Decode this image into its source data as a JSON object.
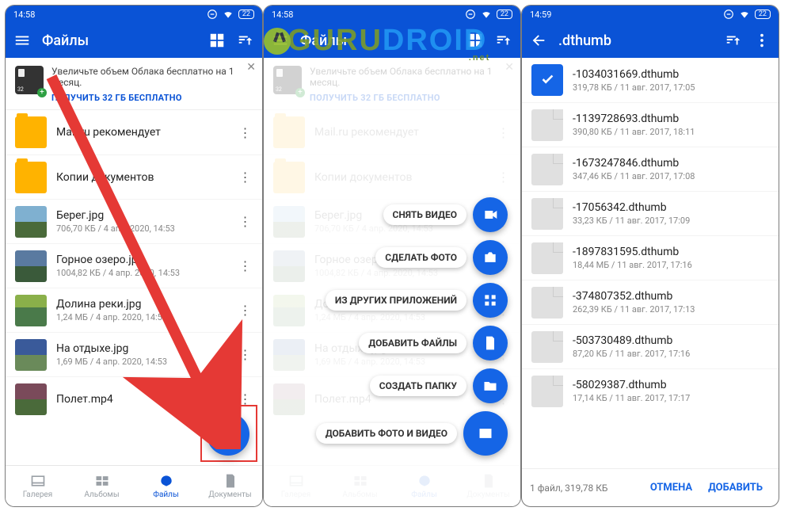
{
  "watermark": {
    "text1": "GURU",
    "text2": "DROID",
    "net": ".net"
  },
  "status": {
    "time": "14:58",
    "digit": "22"
  },
  "status3": {
    "time": "14:59",
    "digit": "22"
  },
  "p1": {
    "title": "Файлы",
    "promo_line": "Увеличьте объем Облака бесплатно на 1 месяц.",
    "promo_cta": "ПОЛУЧИТЬ 32 ГБ БЕСПЛАТНО",
    "rows": [
      {
        "name": "Mail.ru рекомендует",
        "meta": "",
        "t": "folder"
      },
      {
        "name": "Копии документов",
        "meta": "",
        "t": "folder"
      },
      {
        "name": "Берег.jpg",
        "meta": "706,70 КБ / 4 апр. 2020, 14:53",
        "t": "img1"
      },
      {
        "name": "Горное озеро.jpg",
        "meta": "1004,82 КБ / 4 апр. 2020, 14:53",
        "t": "img2"
      },
      {
        "name": "Долина реки.jpg",
        "meta": "1,24 МБ / 4 апр. 2020, 14:53",
        "t": "img3"
      },
      {
        "name": "На отдыхе.jpg",
        "meta": "1,69 МБ / 4 апр. 2020, 14:53",
        "t": "img4"
      },
      {
        "name": "Полет.mp4",
        "meta": "",
        "t": "img5"
      }
    ],
    "nav": [
      "Галерея",
      "Альбомы",
      "Файлы",
      "Документы"
    ]
  },
  "p2": {
    "menu": [
      {
        "label": "СНЯТЬ ВИДЕО",
        "icon": "video"
      },
      {
        "label": "СДЕЛАТЬ ФОТО",
        "icon": "camera"
      },
      {
        "label": "ИЗ ДРУГИХ ПРИЛОЖЕНИЙ",
        "icon": "apps"
      },
      {
        "label": "ДОБАВИТЬ ФАЙЛЫ",
        "icon": "file"
      },
      {
        "label": "СОЗДАТЬ ПАПКУ",
        "icon": "folder"
      },
      {
        "label": "ДОБАВИТЬ ФОТО И ВИДЕО",
        "icon": "image"
      }
    ]
  },
  "p3": {
    "title": ".dthumb",
    "rows": [
      {
        "name": "-1034031669.dthumb",
        "meta": "319,78 КБ / 11 авг. 2017, 17:05",
        "sel": true
      },
      {
        "name": "-1139728693.dthumb",
        "meta": "390,80 КБ / 11 авг. 2017, 18:11"
      },
      {
        "name": "-1673247846.dthumb",
        "meta": "347,46 КБ / 11 авг. 2017, 17:08"
      },
      {
        "name": "-17056342.dthumb",
        "meta": "33,23 КБ / 11 авг. 2017, 17:09"
      },
      {
        "name": "-1897831595.dthumb",
        "meta": "18,44 МБ / 11 авг. 2017, 17:16"
      },
      {
        "name": "-374807352.dthumb",
        "meta": "262,39 КБ / 11 авг. 2017, 17:13"
      },
      {
        "name": "-503730489.dthumb",
        "meta": "87,20 КБ / 11 авг. 2017, 17:16"
      },
      {
        "name": "-58029387.dthumb",
        "meta": "17,14 КБ / 11 авг. 2017, 17:17"
      }
    ],
    "footer_info": "1 файл, 319,78 КБ",
    "cancel": "ОТМЕНА",
    "add": "ДОБАВИТЬ"
  }
}
